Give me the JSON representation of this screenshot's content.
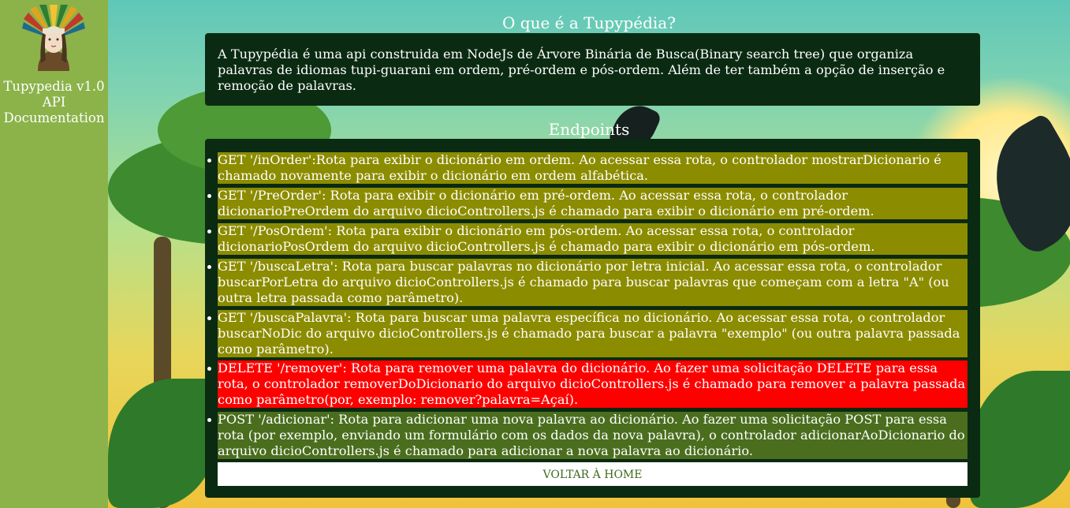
{
  "sidebar": {
    "title_line1": "Tupypedia v1.0",
    "title_line2": "API",
    "title_line3": "Documentation"
  },
  "intro": {
    "heading": "O que é a Tupypédia?",
    "text": "A Tupypédia é uma api construida em NodeJs de Árvore Binária de Busca(Binary search tree) que organiza palavras de idiomas tupi-guarani em ordem, pré-ordem e pós-ordem. Além de ter também a opção de inserção e remoção de palavras."
  },
  "endpoints": {
    "heading": "Endpoints",
    "items": [
      {
        "text": "GET '/inOrder':Rota para exibir o dicionário em ordem. Ao acessar essa rota, o controlador mostrarDicionario é chamado novamente para exibir o dicionário em ordem alfabética.",
        "color": "#8c8c00"
      },
      {
        "text": "GET '/PreOrder': Rota para exibir o dicionário em pré-ordem. Ao acessar essa rota, o controlador dicionarioPreOrdem do arquivo dicioControllers.js é chamado para exibir o dicionário em pré-ordem.",
        "color": "#8c8c00"
      },
      {
        "text": "GET '/PosOrdem': Rota para exibir o dicionário em pós-ordem. Ao acessar essa rota, o controlador dicionarioPosOrdem do arquivo dicioControllers.js é chamado para exibir o dicionário em pós-ordem.",
        "color": "#8c8c00"
      },
      {
        "text": "GET '/buscaLetra': Rota para buscar palavras no dicionário por letra inicial. Ao acessar essa rota, o controlador buscarPorLetra do arquivo dicioControllers.js é chamado para buscar palavras que começam com a letra \"A\" (ou outra letra passada como parâmetro).",
        "color": "#8c8c00"
      },
      {
        "text": "GET '/buscaPalavra': Rota para buscar uma palavra específica no dicionário. Ao acessar essa rota, o controlador buscarNoDic do arquivo dicioControllers.js é chamado para buscar a palavra \"exemplo\" (ou outra palavra passada como parâmetro).",
        "color": "#8c8c00"
      },
      {
        "text": "DELETE '/remover': Rota para remover uma palavra do dicionário. Ao fazer uma solicitação DELETE para essa rota, o controlador removerDoDicionario do arquivo dicioControllers.js é chamado para remover a palavra passada como parâmetro(por, exemplo: remover?palavra=Açaí).",
        "color": "#ff0000"
      },
      {
        "text": "POST '/adicionar': Rota para adicionar uma nova palavra ao dicionário. Ao fazer uma solicitação POST para essa rota (por exemplo, enviando um formulário com os dados da nova palavra), o controlador adicionarAoDicionario do arquivo dicioControllers.js é chamado para adicionar a nova palavra ao dicionário.",
        "color": "#4a6e1e"
      }
    ],
    "home_button": "VOLTAR À HOME"
  },
  "colors": {
    "sidebar": "#8bb34a",
    "panel": "#0b2a12",
    "get": "#8c8c00",
    "delete": "#ff0000",
    "post": "#4a6e1e"
  }
}
